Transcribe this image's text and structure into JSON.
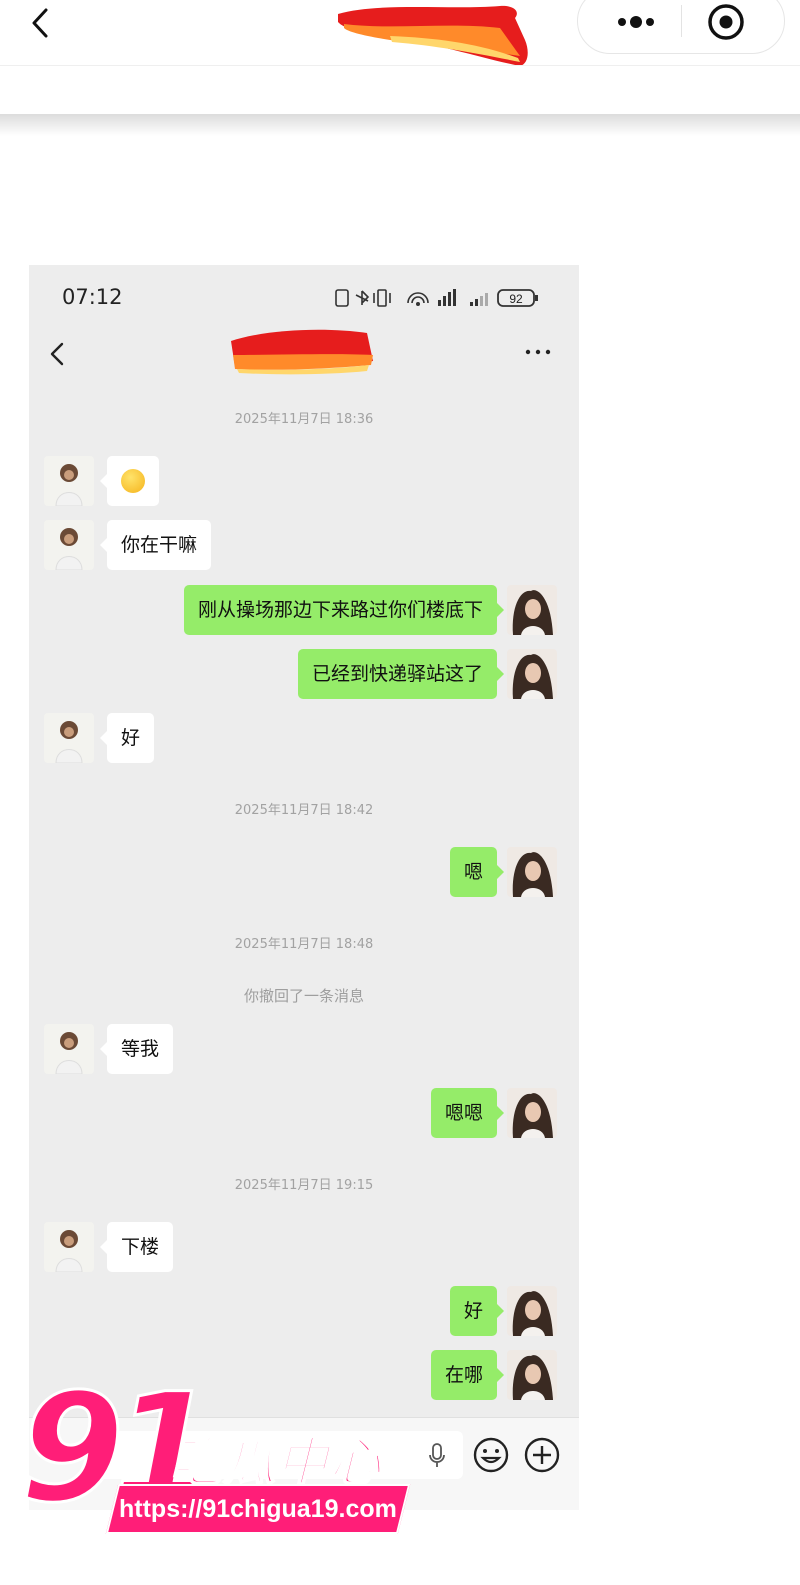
{
  "outer_bar": {
    "back_icon": "chevron-left-icon",
    "title_redacted": true,
    "more_icon": "more-dots-icon",
    "close_icon": "target-close-icon"
  },
  "status_bar": {
    "time": "07:12",
    "battery": "92"
  },
  "chat_header": {
    "title_redacted": true,
    "back_icon": "chevron-left-icon",
    "more_icon": "ellipsis-icon"
  },
  "messages": {
    "ts1": "2025年11月7日 18:36",
    "m1": "emoji",
    "m2": "你在干嘛",
    "m3": "刚从操场那边下来路过你们楼底下",
    "m4": "已经到快递驿站这了",
    "m5": "好",
    "ts2": "2025年11月7日 18:42",
    "m6": "嗯",
    "ts3": "2025年11月7日 18:48",
    "recall_notice": "你撤回了一条消息",
    "m7": "等我",
    "m8": "嗯嗯",
    "ts4": "2025年11月7日 19:15",
    "m9": "下楼",
    "m10": "好",
    "m11": "在哪"
  },
  "input_bar": {
    "voice_icon": "microphone-icon",
    "emoji_icon": "smiley-icon",
    "plus_icon": "plus-circle-icon"
  },
  "watermark": {
    "number": "91",
    "name": "吃瓜中心",
    "url": "https://91chigua19.com"
  },
  "colors": {
    "sent_bubble": "#95ec69",
    "received_bubble": "#ffffff",
    "chat_background": "#ededed",
    "watermark_pink": "#ff1e78"
  }
}
